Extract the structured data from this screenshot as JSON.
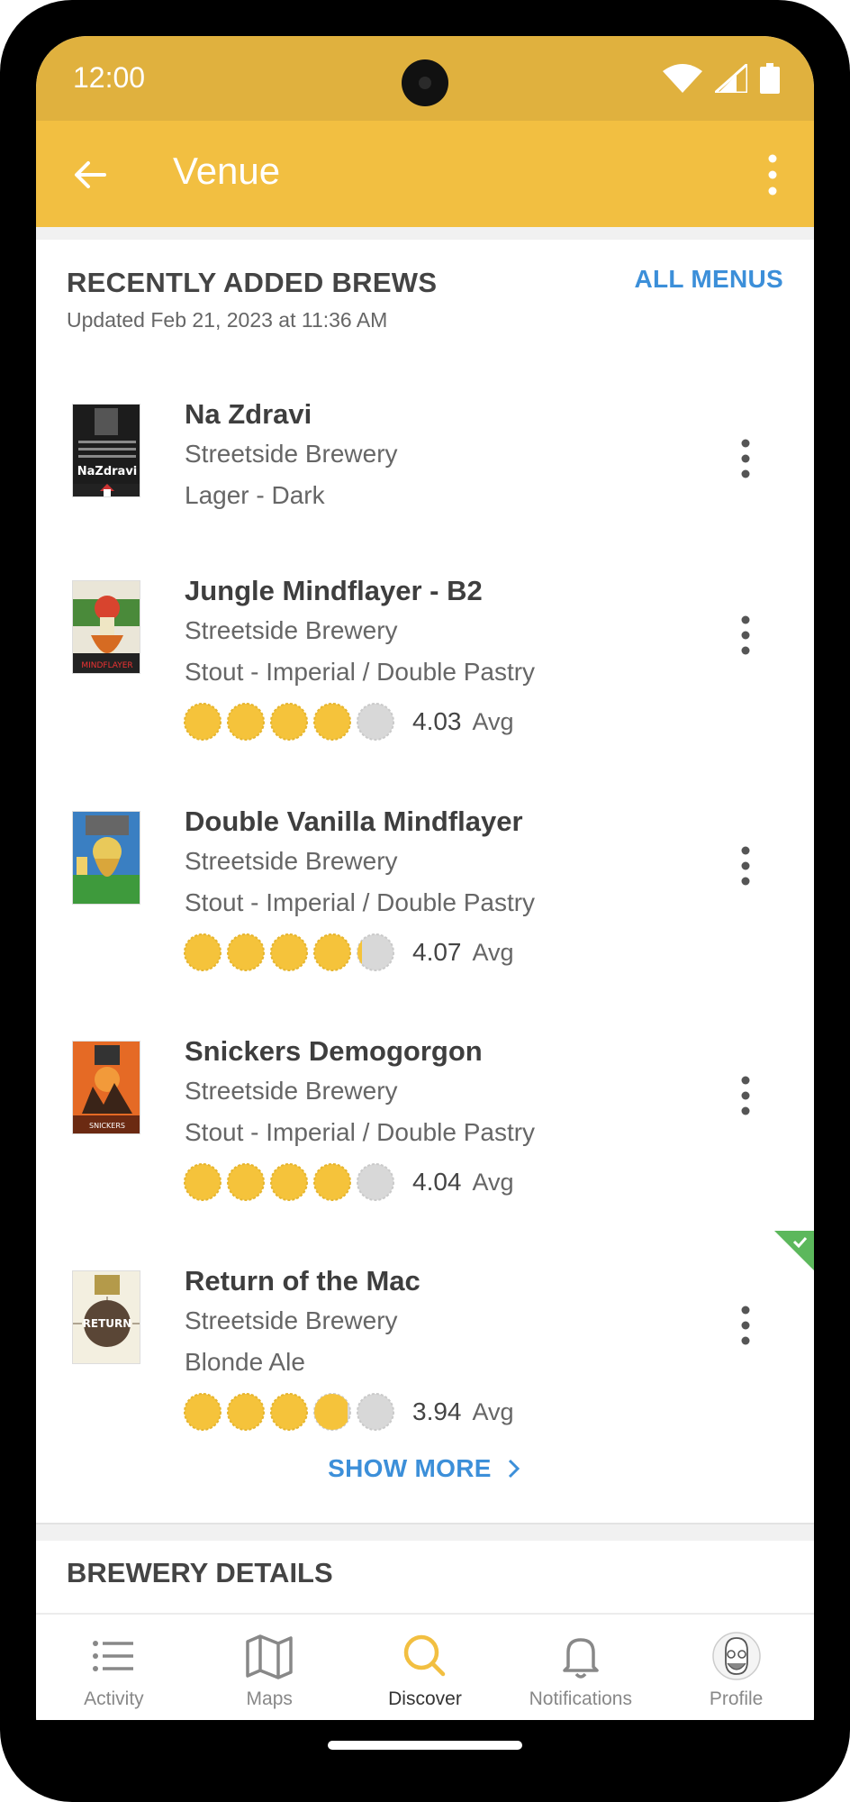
{
  "status": {
    "time": "12:00"
  },
  "app_bar": {
    "title": "Venue"
  },
  "section": {
    "title": "RECENTLY ADDED BREWS",
    "all_menus": "ALL MENUS",
    "updated": "Updated Feb 21, 2023 at 11:36 AM"
  },
  "beers": [
    {
      "name": "Na Zdravi",
      "brewery": "Streetside Brewery",
      "style": "Lager - Dark",
      "rating": null,
      "avg_label": ""
    },
    {
      "name": "Jungle Mindflayer - B2",
      "brewery": "Streetside Brewery",
      "style": "Stout - Imperial / Double Pastry",
      "rating": "4.03",
      "avg_label": "Avg"
    },
    {
      "name": "Double Vanilla Mindflayer",
      "brewery": "Streetside Brewery",
      "style": "Stout - Imperial / Double Pastry",
      "rating": "4.07",
      "avg_label": "Avg"
    },
    {
      "name": "Snickers Demogorgon",
      "brewery": "Streetside Brewery",
      "style": "Stout - Imperial / Double Pastry",
      "rating": "4.04",
      "avg_label": "Avg"
    },
    {
      "name": "Return of the Mac",
      "brewery": "Streetside Brewery",
      "style": "Blonde Ale",
      "rating": "3.94",
      "avg_label": "Avg"
    }
  ],
  "show_more": "SHOW MORE",
  "brewery_details": "BREWERY DETAILS",
  "nav": {
    "items": [
      {
        "label": "Activity",
        "icon": "list-icon"
      },
      {
        "label": "Maps",
        "icon": "map-icon"
      },
      {
        "label": "Discover",
        "icon": "search-icon",
        "active": true
      },
      {
        "label": "Notifications",
        "icon": "bell-icon"
      },
      {
        "label": "Profile",
        "icon": "avatar-icon"
      }
    ]
  },
  "colors": {
    "status_bar": "#e0b13e",
    "app_bar": "#f2bf41",
    "accent_blue": "#3c8fd9",
    "cap_yellow": "#f5c33b",
    "cap_gray": "#d8d8d8",
    "checkin_green": "#5cb85c"
  }
}
